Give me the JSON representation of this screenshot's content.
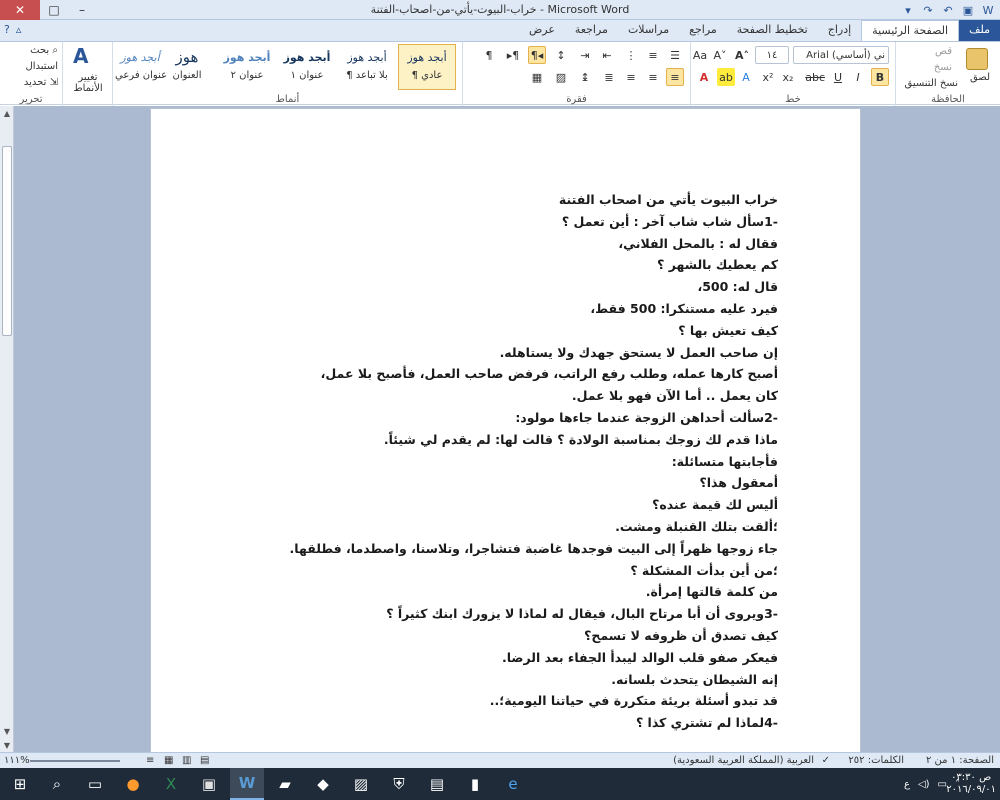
{
  "window": {
    "title": "خراب-البيوت-يأتي-من-اصحاب-الفتنة - Microsoft Word",
    "minimize": "–",
    "maximize": "□",
    "close": "✕"
  },
  "tabs": {
    "file": "ملف",
    "home": "الصفحة الرئيسية",
    "insert": "إدراج",
    "layout": "تخطيط الصفحة",
    "references": "مراجع",
    "mailings": "مراسلات",
    "review": "مراجعة",
    "view": "عرض"
  },
  "ribbon": {
    "clipboard": {
      "paste": "لصق",
      "cut": "قص",
      "copy": "نسخ",
      "format_painter": "نسخ التنسيق",
      "label": "الحافظة"
    },
    "font": {
      "name": "Arial (أساسي) ني",
      "size": "١٤",
      "label": "خط"
    },
    "paragraph": {
      "label": "فقرة"
    },
    "styles": {
      "label": "أنماط",
      "items": [
        {
          "sample": "أبجد هوز",
          "name": "¶ عادي"
        },
        {
          "sample": "أبجد هوز",
          "name": "¶ بلا تباعد"
        },
        {
          "sample": "أبجد هوز",
          "name": "عنوان ١"
        },
        {
          "sample": "أبجد هوز",
          "name": "عنوان ٢"
        },
        {
          "sample": "هوز",
          "name": "العنوان"
        },
        {
          "sample": "أبجد هوز",
          "name": "عنوان فرعي"
        }
      ],
      "change_styles": "تغيير الأنماط"
    },
    "editing": {
      "find": "بحث",
      "replace": "استبدال",
      "select": "تحديد",
      "label": "تحرير"
    }
  },
  "document": {
    "lines": [
      "خراب البيوت يأتي من اصحاب الفتنة",
      "-1سأل شاب شاب آخر : أين تعمل ؟",
      "فقال له : بالمحل الفلاني،",
      "كم يعطيك بالشهر ؟",
      "قال له: 500،",
      "فيرد عليه مستنكرا: 500 فقط،",
      "كيف تعيش بها ؟",
      "إن صاحب العمل لا يستحق جهدك ولا يستاهله.",
      "أصبح كارها عمله، وطلب رفع الراتب، فرفض صاحب العمل، فأصبح بلا عمل،",
      "كان يعمل .. أما الآن فهو بلا عمل.",
      "-2سألت أحداهن الزوجة عندما جاءها مولود:",
      "ماذا قدم لك زوجك بمناسبة الولادة ؟ قالت لها: لم يقدم لي شيئاً.",
      "فأجابتها متسائلة:",
      "أمعقول هذا؟",
      "أليس لك قيمة عنده؟",
      "؛ألقت بتلك القنبلة ومشت.",
      "جاء زوجها ظهراً إلى البيت فوجدها غاضبة فتشاجرا، وتلاسنا، واصطدما، فطلقها.",
      "؛من أين بدأت المشكلة ؟",
      "من كلمة قالتها إمرأة.",
      "-3ويروى أن أبا مرتاح البال، فيقال له لماذا لا يزورك ابنك كثيراً ؟",
      "كيف تصدق أن ظروفه لا تسمح؟",
      "فيعكر صفو قلب الوالد ليبدأ الجفاء بعد الرضا.",
      "إنه الشيطان يتحدث بلسانه.",
      "قد تبدو أسئلة بريئة متكررة في حياتنا اليومية؛..",
      "-4لماذا لم تشتري كذا ؟"
    ]
  },
  "statusbar": {
    "page": "الصفحة: ١ من ٢",
    "words": "الكلمات: ٢٥٢",
    "language": "العربية (المملكة العربية السعودية)",
    "zoom": "١١١%"
  },
  "taskbar": {
    "time": "ص ٠٣:٣٠",
    "date": "٢٠١٦/٠٩/٠١",
    "lang": "ع"
  },
  "colors": {
    "file_tab": "#2b579a",
    "titlebar": "#dfe9f5",
    "workspace": "#abbad0",
    "taskbar": "#1f2b38"
  }
}
